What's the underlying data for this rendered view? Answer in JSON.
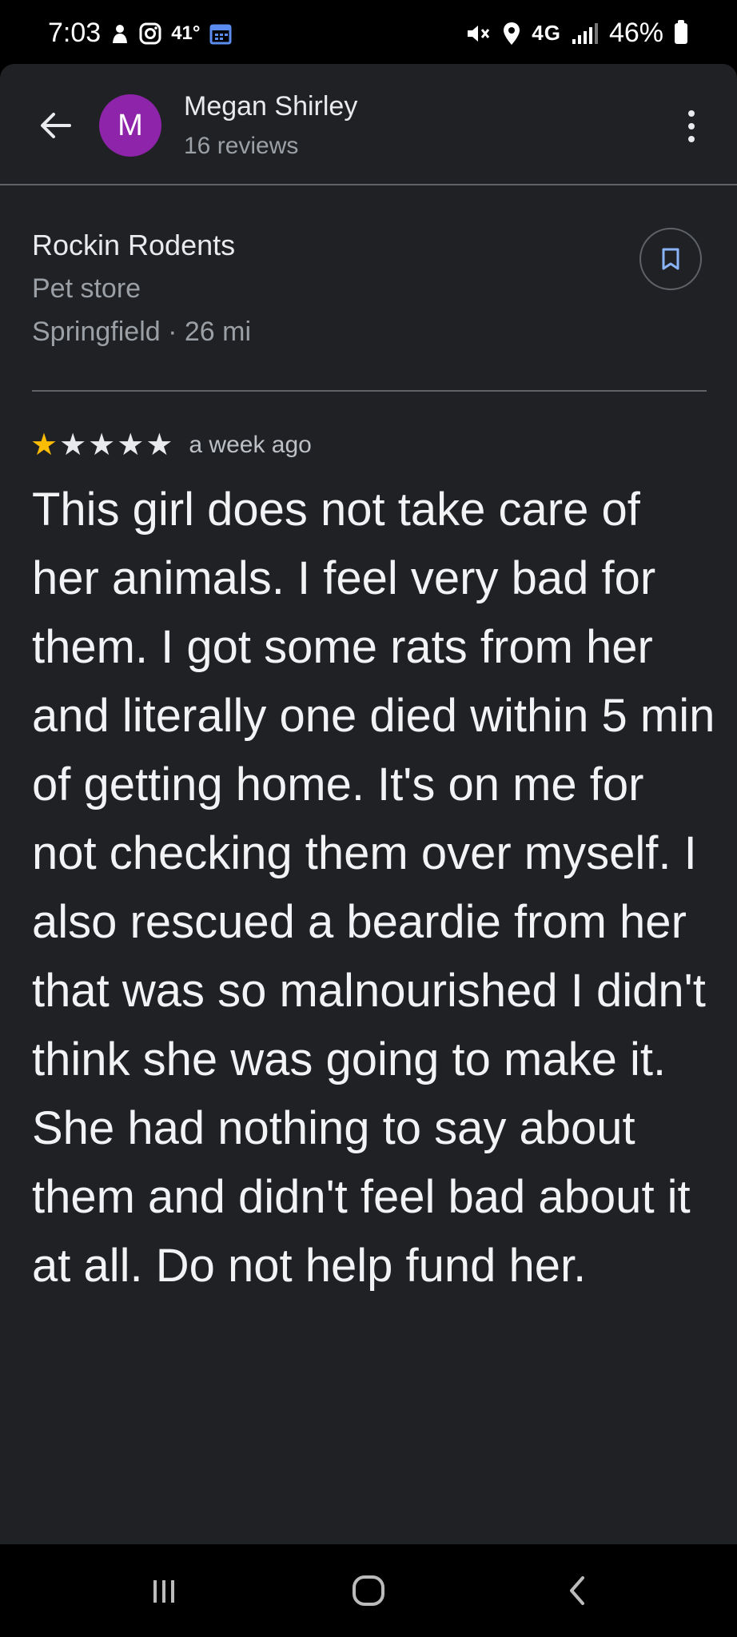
{
  "status_bar": {
    "time": "7:03",
    "temperature": "41°",
    "network": "4G",
    "battery": "46%",
    "icons": [
      "notification-icon",
      "instagram-icon",
      "calendar-icon",
      "mute-icon",
      "location-icon",
      "signal-icon",
      "battery-icon"
    ]
  },
  "header": {
    "reviewer_initial": "M",
    "reviewer_name": "Megan Shirley",
    "review_count": "16 reviews",
    "avatar_color": "#8e24aa"
  },
  "place": {
    "name": "Rockin Rodents",
    "category": "Pet store",
    "location": "Springfield · 26 mi"
  },
  "review": {
    "rating": 1,
    "max_rating": 5,
    "time_ago": "a week ago",
    "text": "This girl does not take care of her animals. I feel very bad for them. I got some rats from her and literally one died within 5 min of getting home. It's on me for not checking them over myself. I also rescued a beardie from her that was so malnourished I didn't think she was going to make it. She had nothing to say about them and didn't feel bad about it at all. Do not help fund her."
  },
  "colors": {
    "background": "#202124",
    "star_filled": "#fbbc04",
    "star_empty": "#e8eaed",
    "secondary_text": "#9aa0a6"
  }
}
